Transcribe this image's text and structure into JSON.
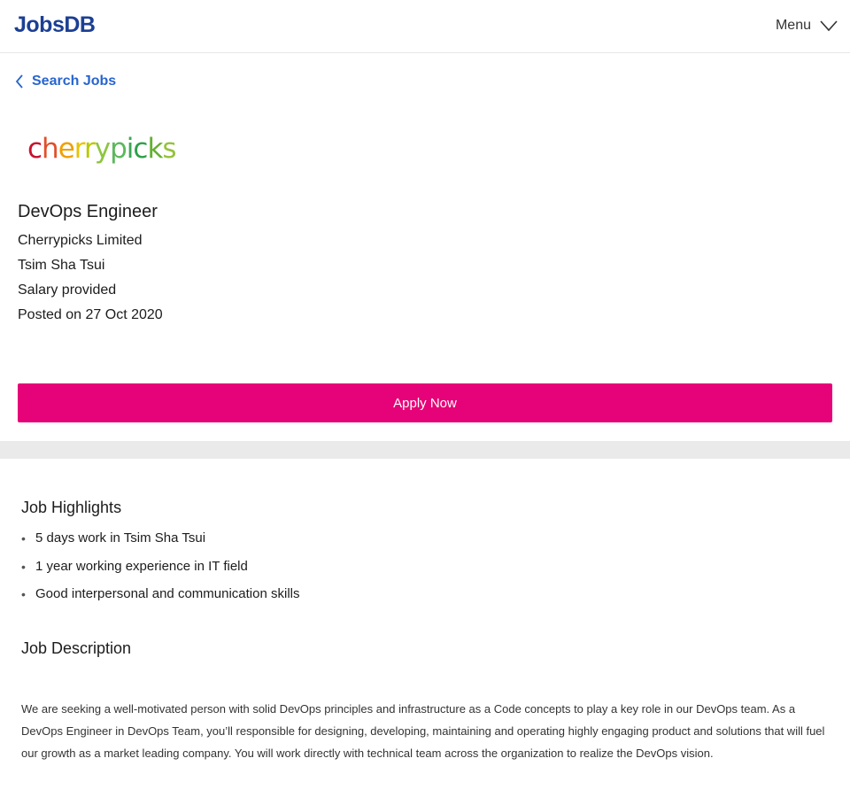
{
  "header": {
    "logo_text": "JobsDB",
    "menu_label": "Menu",
    "menu_icon": "chevron-down-icon",
    "brand_color": "#1c3f94"
  },
  "nav": {
    "back_label": "Search Jobs",
    "back_icon": "chevron-left-icon",
    "link_color": "#2765cf"
  },
  "company_logo": {
    "letters": [
      "c",
      "h",
      "e",
      "r",
      "r",
      "y",
      "p",
      "i",
      "c",
      "k",
      "s"
    ],
    "colors": [
      "#c8102e",
      "#e0502a",
      "#f0a000",
      "#e8c400",
      "#b8c800",
      "#8cc63f",
      "#5cb85c",
      "#3aa655",
      "#2ea04a",
      "#63b030",
      "#96c23c"
    ]
  },
  "job": {
    "title": "DevOps Engineer",
    "company": "Cherrypicks Limited",
    "location": "Tsim Sha Tsui",
    "salary": "Salary provided",
    "posted": "Posted on 27 Oct 2020"
  },
  "apply": {
    "label": "Apply Now",
    "color": "#e60278"
  },
  "highlights": {
    "title": "Job Highlights",
    "items": [
      "5 days work in Tsim Sha Tsui",
      "1 year working experience in IT field",
      "Good interpersonal and communication skills"
    ]
  },
  "description": {
    "title": "Job Description",
    "text": "We are seeking a well-motivated person with solid DevOps principles and infrastructure as a Code concepts to play a key role in our DevOps team. As a DevOps Engineer in DevOps Team, you’ll responsible for designing, developing, maintaining and operating highly engaging product and solutions that will fuel our growth as a market leading company. You will work directly with technical team across the organization to realize the DevOps vision."
  }
}
